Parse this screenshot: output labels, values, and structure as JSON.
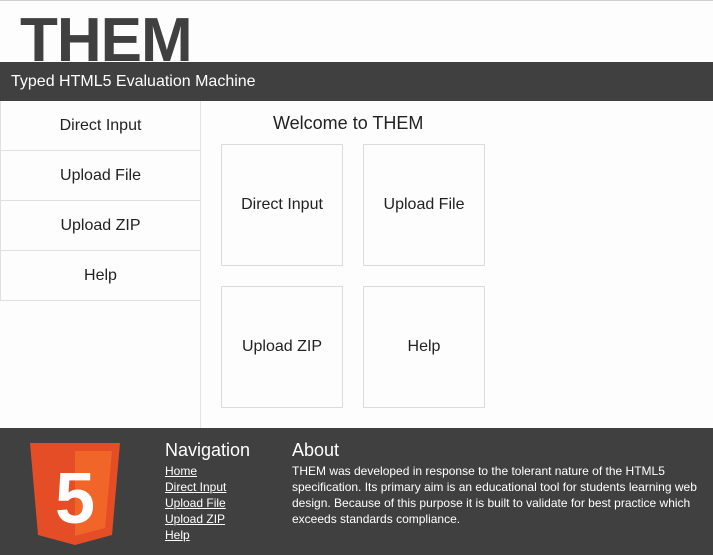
{
  "header": {
    "logo_text": "THEM",
    "subtitle": "Typed HTML5 Evaluation Machine"
  },
  "sidebar": {
    "items": [
      {
        "label": "Direct Input"
      },
      {
        "label": "Upload File"
      },
      {
        "label": "Upload ZIP"
      },
      {
        "label": "Help"
      }
    ]
  },
  "main": {
    "heading": "Welcome to THEM",
    "tiles": [
      {
        "label": "Direct Input"
      },
      {
        "label": "Upload File"
      },
      {
        "label": "Upload ZIP"
      },
      {
        "label": "Help"
      }
    ]
  },
  "footer": {
    "logo_icon": "html5-icon",
    "logo_digit": "5",
    "navigation": {
      "heading": "Navigation",
      "links": [
        {
          "label": "Home"
        },
        {
          "label": "Direct Input"
        },
        {
          "label": "Upload File"
        },
        {
          "label": "Upload ZIP"
        },
        {
          "label": "Help"
        }
      ]
    },
    "about": {
      "heading": "About",
      "text": "THEM was developed in response to the tolerant nature of the HTML5 specification. Its primary aim is an educational tool for students learning web design. Because of this purpose it is built to validate for best practice which exceeds standards compliance."
    }
  },
  "colors": {
    "dark_bar": "#404040",
    "html5_orange": "#e44d26",
    "html5_orange_light": "#f16529"
  }
}
